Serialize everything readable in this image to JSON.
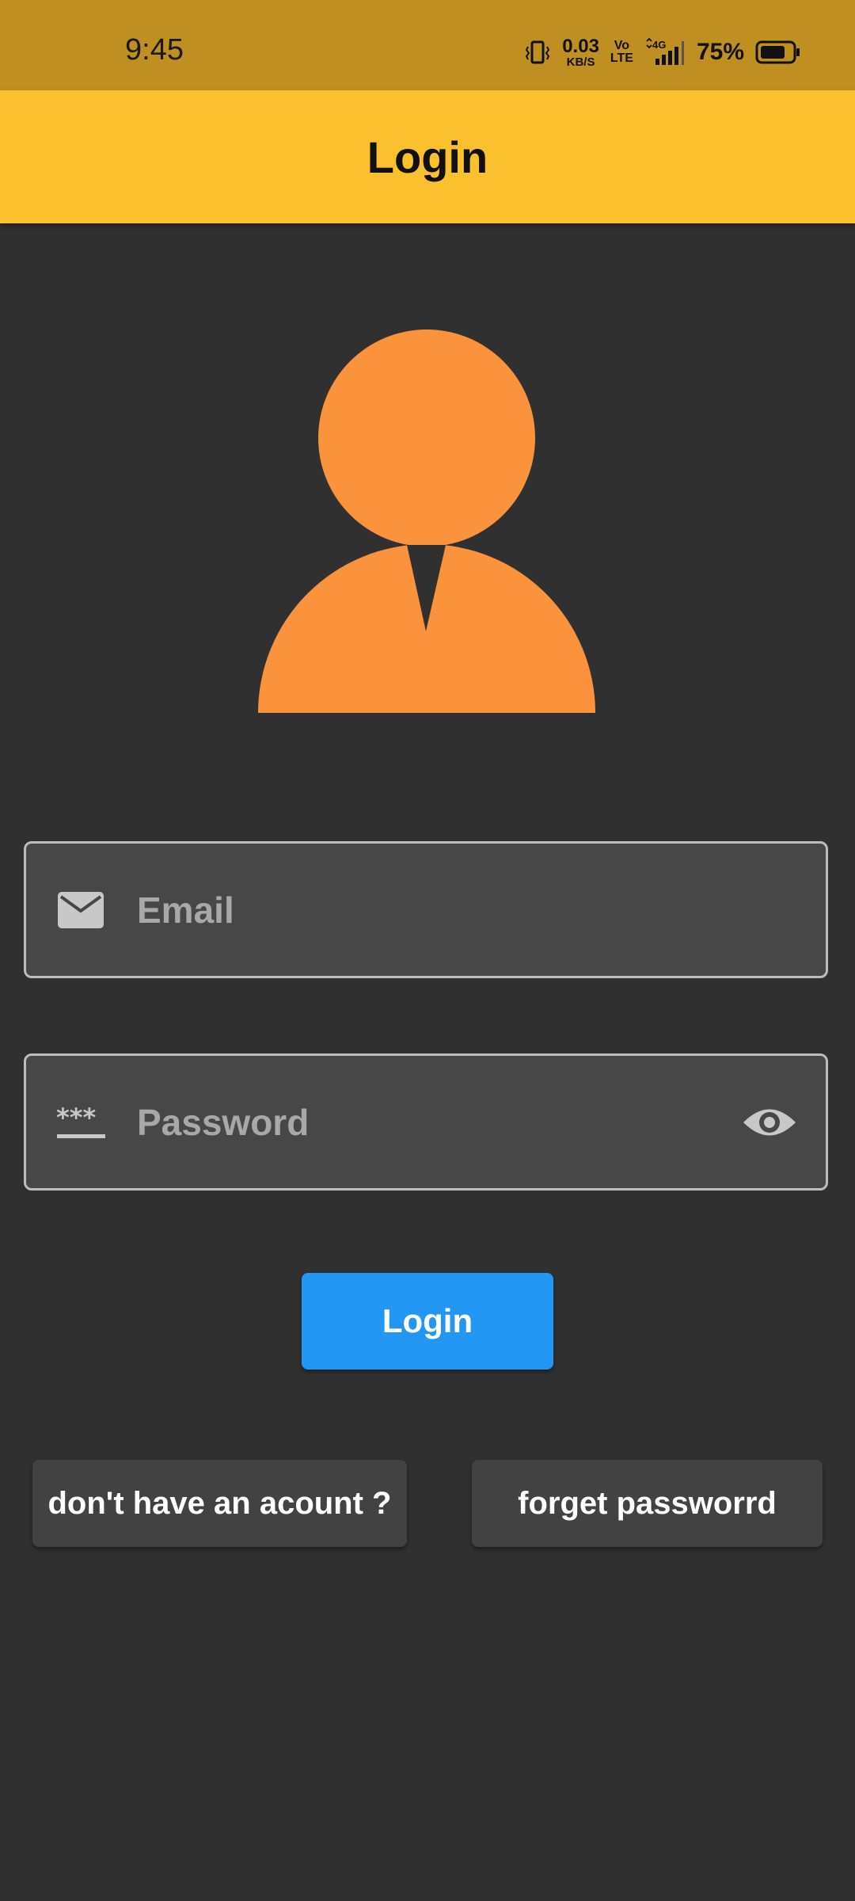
{
  "status_bar": {
    "time": "9:45",
    "net_speed_value": "0.03",
    "net_speed_unit": "KB/S",
    "volte_top": "Vo",
    "volte_bottom": "LTE",
    "network_type": "4G",
    "battery_percent": "75%",
    "battery_level": 0.75,
    "icons": [
      "vibrate-icon",
      "signal-icon",
      "battery-icon"
    ]
  },
  "app_bar": {
    "title": "Login",
    "color": "#FBC02D"
  },
  "avatar": {
    "icon": "user-avatar-icon",
    "color": "#FB923C"
  },
  "form": {
    "email": {
      "placeholder": "Email",
      "value": "",
      "icon": "mail-icon"
    },
    "password": {
      "placeholder": "Password",
      "value": "",
      "icon": "password-icon",
      "toggle_icon": "eye-icon"
    },
    "login_label": "Login",
    "login_color": "#2196F3"
  },
  "links": {
    "signup_label": "don't have an acount ?",
    "forgot_label": "forget passworrd"
  }
}
